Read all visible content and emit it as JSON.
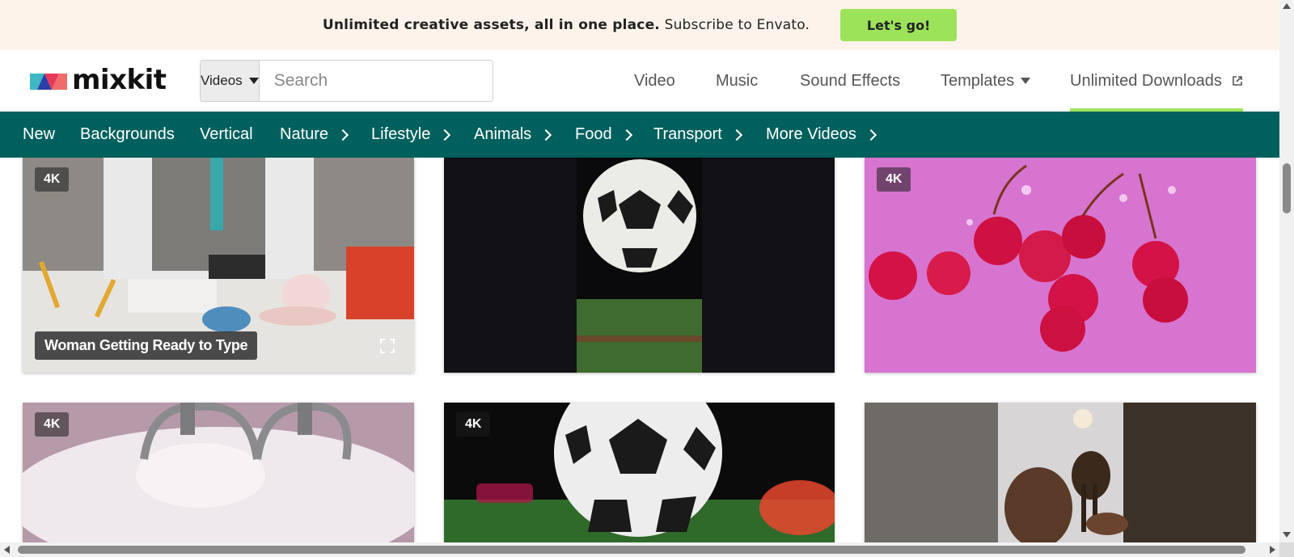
{
  "promo": {
    "bold_text": "Unlimited creative assets, all in one place.",
    "text": " Subscribe to Envato.",
    "button_label": "Let's go!"
  },
  "header": {
    "logo_text": "mixkit",
    "search": {
      "type_label": "Videos",
      "placeholder": "Search",
      "value": ""
    },
    "nav": [
      {
        "label": "Video"
      },
      {
        "label": "Music"
      },
      {
        "label": "Sound Effects"
      },
      {
        "label": "Templates"
      },
      {
        "label": "Unlimited Downloads"
      }
    ]
  },
  "categories": [
    {
      "label": "New"
    },
    {
      "label": "Backgrounds"
    },
    {
      "label": "Vertical"
    },
    {
      "label": "Nature"
    },
    {
      "label": "Lifestyle"
    },
    {
      "label": "Animals"
    },
    {
      "label": "Food"
    },
    {
      "label": "Transport"
    },
    {
      "label": "More Videos"
    }
  ],
  "videos": [
    {
      "badge": "4K",
      "caption": "Woman Getting Ready to Type"
    },
    {
      "badge": ""
    },
    {
      "badge": "4K"
    },
    {
      "badge": "4K"
    },
    {
      "badge": "4K"
    },
    {
      "badge": ""
    }
  ],
  "colors": {
    "promo_bg": "#fdf3ea",
    "accent_green": "#9ce35a",
    "category_bar": "#00605d"
  },
  "icons": [
    "mixkit-logo-icon",
    "caret-down-icon",
    "search-icon",
    "external-link-icon",
    "chevron-right-icon",
    "expand-icon"
  ]
}
